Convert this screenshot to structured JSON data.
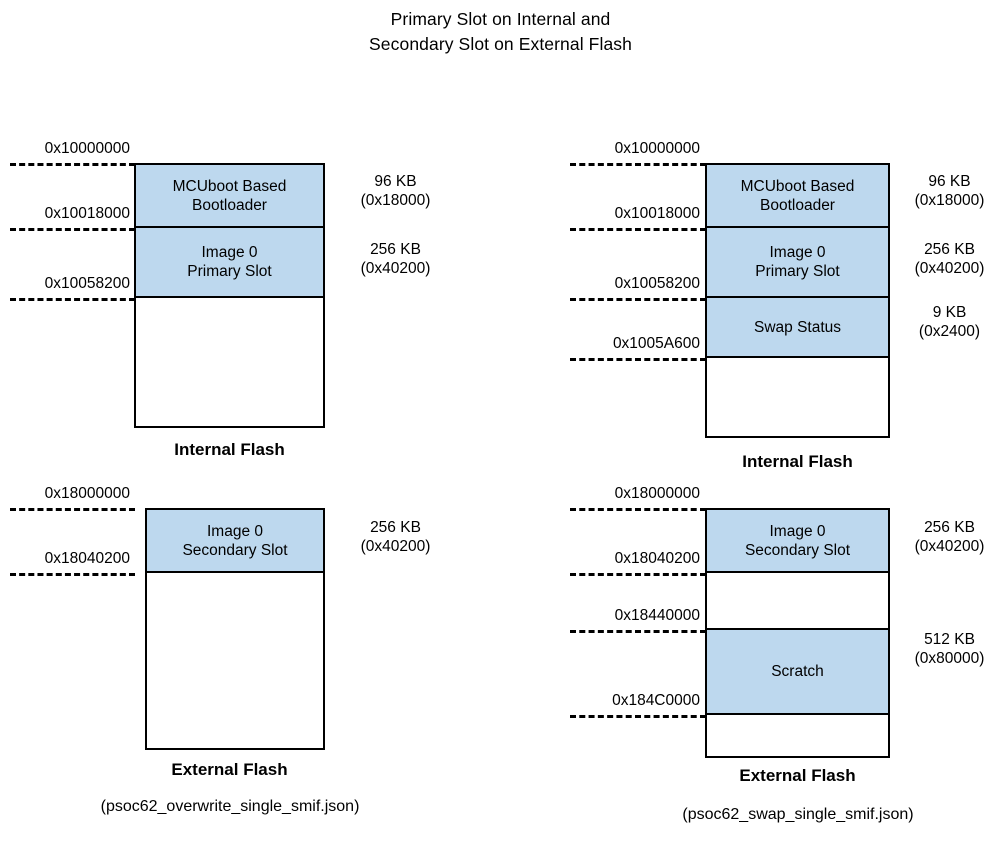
{
  "title": {
    "line1": "Primary Slot on Internal and",
    "line2": "Secondary Slot on External Flash"
  },
  "colors": {
    "region_fill": "#bdd8ee",
    "outline": "#000000",
    "background": "#ffffff"
  },
  "left_panel": {
    "caption": "(psoc62_overwrite_single_smif.json)",
    "internal": {
      "name": "Internal Flash",
      "addresses": [
        "0x10000000",
        "0x10018000",
        "0x10058200"
      ],
      "regions": [
        {
          "label_line1": "MCUboot Based",
          "label_line2": "Bootloader",
          "size": "96 KB",
          "size_hex": "(0x18000)",
          "filled": true
        },
        {
          "label_line1": "Image 0",
          "label_line2": "Primary Slot",
          "size": "256 KB",
          "size_hex": "(0x40200)",
          "filled": true
        },
        {
          "label_line1": "",
          "label_line2": "",
          "size": "",
          "size_hex": "",
          "filled": false
        }
      ]
    },
    "external": {
      "name": "External Flash",
      "addresses": [
        "0x18000000",
        "0x18040200"
      ],
      "regions": [
        {
          "label_line1": "Image 0",
          "label_line2": "Secondary Slot",
          "size": "256 KB",
          "size_hex": "(0x40200)",
          "filled": true
        },
        {
          "label_line1": "",
          "label_line2": "",
          "size": "",
          "size_hex": "",
          "filled": false
        }
      ]
    }
  },
  "right_panel": {
    "caption": "(psoc62_swap_single_smif.json)",
    "internal": {
      "name": "Internal Flash",
      "addresses": [
        "0x10000000",
        "0x10018000",
        "0x10058200",
        "0x1005A600"
      ],
      "regions": [
        {
          "label_line1": "MCUboot Based",
          "label_line2": "Bootloader",
          "size": "96 KB",
          "size_hex": "(0x18000)",
          "filled": true
        },
        {
          "label_line1": "Image 0",
          "label_line2": "Primary Slot",
          "size": "256 KB",
          "size_hex": "(0x40200)",
          "filled": true
        },
        {
          "label_line1": "Swap Status",
          "label_line2": "",
          "size": "9 KB",
          "size_hex": "(0x2400)",
          "filled": true
        },
        {
          "label_line1": "",
          "label_line2": "",
          "size": "",
          "size_hex": "",
          "filled": false
        }
      ]
    },
    "external": {
      "name": "External Flash",
      "addresses": [
        "0x18000000",
        "0x18040200",
        "0x18440000",
        "0x184C0000"
      ],
      "regions": [
        {
          "label_line1": "Image 0",
          "label_line2": "Secondary Slot",
          "size": "256 KB",
          "size_hex": "(0x40200)",
          "filled": true
        },
        {
          "label_line1": "",
          "label_line2": "",
          "size": "",
          "size_hex": "",
          "filled": false
        },
        {
          "label_line1": "Scratch",
          "label_line2": "",
          "size": "512 KB",
          "size_hex": "(0x80000)",
          "filled": true
        },
        {
          "label_line1": "",
          "label_line2": "",
          "size": "",
          "size_hex": "",
          "filled": false
        }
      ]
    }
  }
}
